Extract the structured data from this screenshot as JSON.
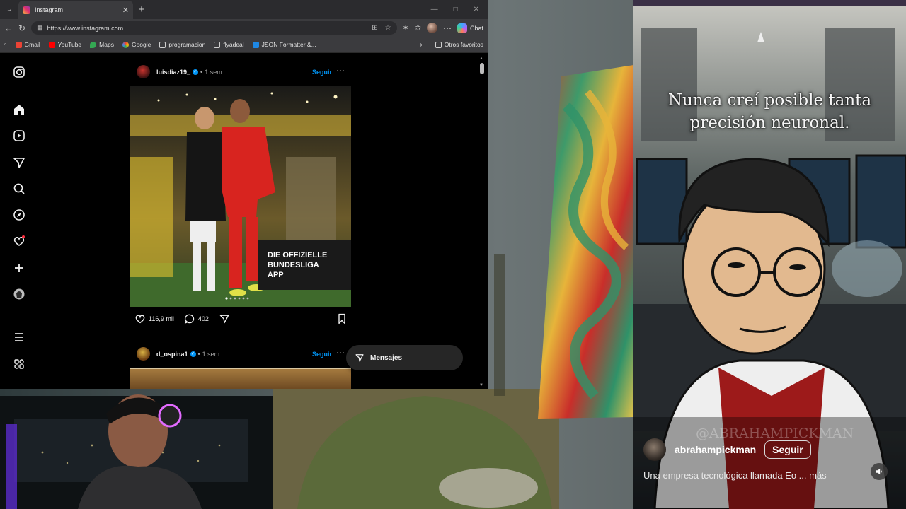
{
  "browser": {
    "tab_title": "Instagram",
    "url": "https://www.instagram.com",
    "chat_label": "Chat",
    "bookmarks": [
      {
        "label": "Gmail",
        "color": "#ffffff"
      },
      {
        "label": "YouTube",
        "color": "#ff0000"
      },
      {
        "label": "Maps",
        "color": "#34a853"
      },
      {
        "label": "Google",
        "color": "#ffffff"
      },
      {
        "label": "programacion",
        "color": "#cfcfcf"
      },
      {
        "label": "flyadeal",
        "color": "#cfcfcf"
      },
      {
        "label": "JSON Formatter &...",
        "color": "#1e88e5"
      }
    ],
    "other_favorites": "Otros favoritos"
  },
  "instagram": {
    "nav_icons": [
      "instagram-icon",
      "home-icon",
      "reels-icon",
      "messages-icon",
      "search-icon",
      "explore-icon",
      "notifications-icon",
      "create-icon",
      "profile-icon",
      "menu-icon",
      "threads-icon"
    ],
    "post1": {
      "username": "luisdiaz19_",
      "time": "1 sem",
      "follow": "Seguir",
      "likes": "116,9 mil",
      "comments": "402",
      "photo_text": "DIE OFFIZIELLE BUNDESLIGA APP"
    },
    "post2": {
      "username": "d_ospina1",
      "time": "1 sem",
      "follow": "Seguir"
    },
    "messages_label": "Mensajes"
  },
  "reel": {
    "caption_line1": "Nunca creí posible tanta",
    "caption_line2": "precisión neuronal.",
    "watermark": "@ABRAHAMPICKMAN",
    "username": "abrahampickman",
    "follow": "Seguir",
    "description": "Una empresa tecnológica llamada Eo ... más"
  }
}
